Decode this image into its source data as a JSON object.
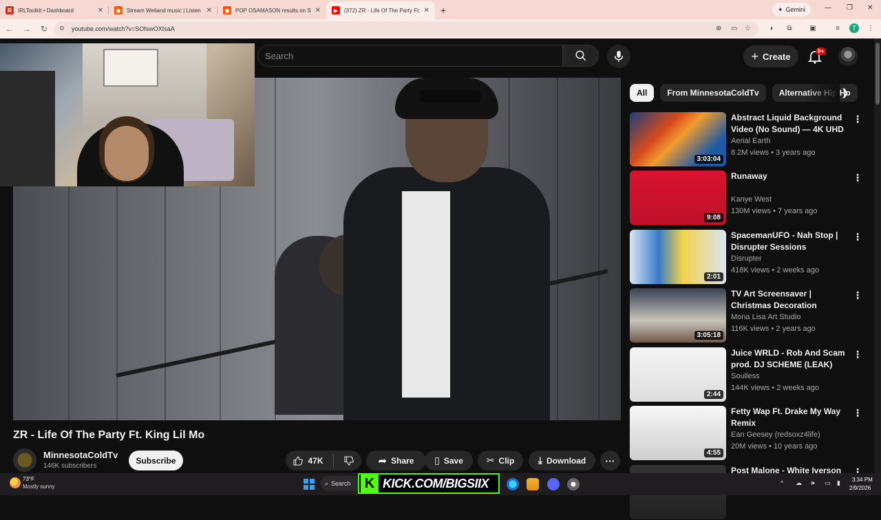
{
  "browser": {
    "tabs": [
      {
        "label": "IRLToolkit • Dashboard",
        "favicon_color": "#d0312d"
      },
      {
        "label": "Stream Weiland music | Listen t",
        "favicon_color": "#ff5500"
      },
      {
        "label": "POP OSAMASON results on Sc",
        "favicon_color": "#ff5500"
      },
      {
        "label": "(372) ZR - Life Of The Party Ft.",
        "favicon_color": "#ff0000"
      }
    ],
    "gemini_label": "Gemini",
    "url": "youtube.com/watch?v=SOfswOXtsaA",
    "profile_initial": "T"
  },
  "youtube": {
    "search_placeholder": "Search",
    "create_label": "Create",
    "notifications_badge": "9+",
    "video": {
      "title": "ZR - Life Of The Party Ft. King Lil Mo",
      "channel": "MinnesotaColdTv",
      "subscribers": "146K subscribers",
      "subscribe_label": "Subscribe",
      "likes": "47K",
      "share_label": "Share",
      "save_label": "Save",
      "clip_label": "Clip",
      "download_label": "Download"
    },
    "chips": [
      "All",
      "From MinnesotaColdTv",
      "Alternative Hip Ho"
    ],
    "recommendations": [
      {
        "title": "Abstract Liquid Background Video (No Sound) — 4K UHD ...",
        "channel": "Aerial Earth",
        "meta": "8.2M views • 3 years ago",
        "duration": "3:03:04",
        "thumb": "linear-gradient(135deg,#1c3f7a 0%,#d84b1d 35%,#f29b2f 50%,#1d5aa3 80%)"
      },
      {
        "title": "Runaway",
        "channel": "Kanye West",
        "meta": "130M views • 7 years ago",
        "duration": "9:08",
        "thumb": "linear-gradient(#d8142f,#c0102a)"
      },
      {
        "title": "SpacemanUFO - Nah Stop | Disrupter Sessions",
        "channel": "Disrupter",
        "meta": "418K views • 2 weeks ago",
        "duration": "2:01",
        "thumb": "linear-gradient(90deg,#d9e6f2 0%,#3a7bc8 30%,#f2d24a 55%,#d9e6f2 100%)"
      },
      {
        "title": "TV Art Screensaver | Christmas Decoration",
        "channel": "Mona Lisa Art Studio",
        "meta": "116K views • 2 years ago",
        "duration": "3:05:18",
        "thumb": "linear-gradient(#3a4150,#c8c4bc 60%,#6e5a4a)"
      },
      {
        "title": "Juice WRLD - Rob And Scam prod. DJ SCHEME (LEAK)",
        "channel": "Soulless",
        "meta": "144K views • 2 weeks ago",
        "duration": "2:44",
        "thumb": "linear-gradient(#f4f4f4,#dedede)"
      },
      {
        "title": "Fetty Wap Ft. Drake  My Way Remix",
        "channel": "Ean Geesey (redsoxz4life)",
        "meta": "20M views • 10 years ago",
        "duration": "4:55",
        "thumb": "linear-gradient(#f6f6f6,#cfcfcf)"
      },
      {
        "title": "Post Malone - White Iverson",
        "channel": "",
        "meta": "",
        "duration": "",
        "thumb": "linear-gradient(#333,#222)"
      }
    ]
  },
  "overlay": {
    "kick_text": "KICK.COM/BIGSIIX"
  },
  "taskbar": {
    "temperature": "73°F",
    "weather": "Mostly sunny",
    "search_label": "Search",
    "time": "3:34 PM",
    "date": "2/9/2026"
  }
}
